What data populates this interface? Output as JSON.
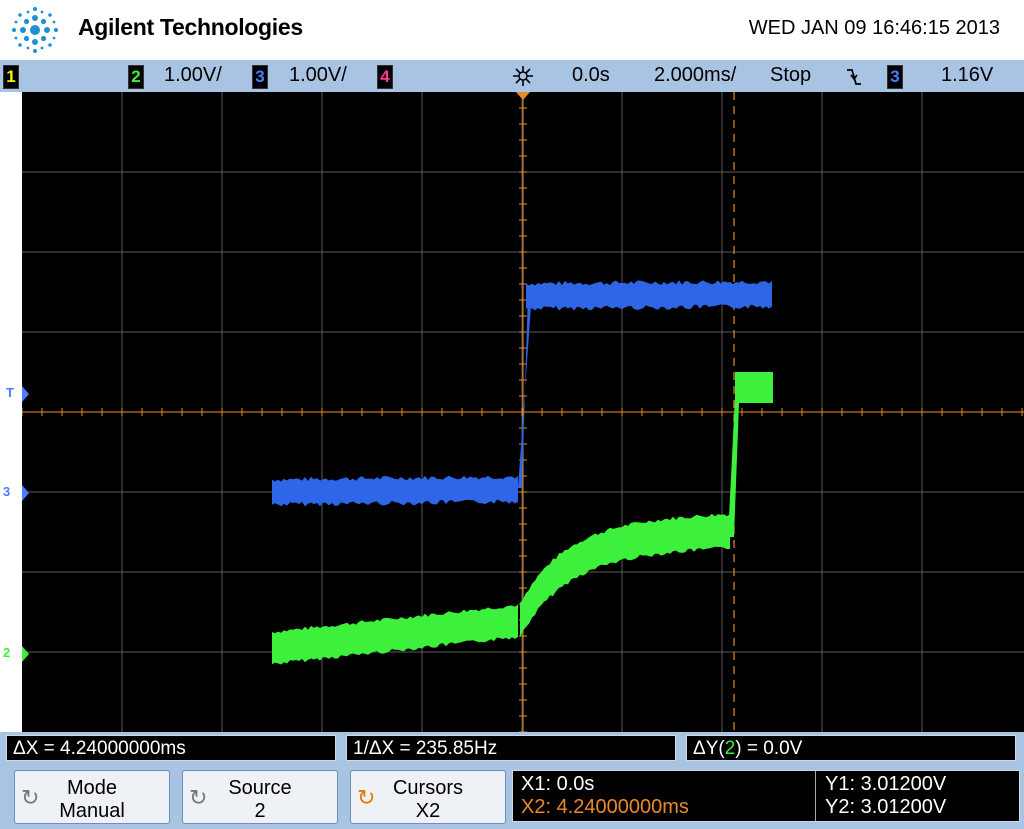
{
  "header": {
    "brand": "Agilent Technologies",
    "datetime": "WED JAN 09 16:46:15 2013"
  },
  "status_bar": {
    "channels": [
      {
        "id": "1",
        "scale": "",
        "color": "#f2f200"
      },
      {
        "id": "2",
        "scale": "1.00V/",
        "color": "#3cf03c"
      },
      {
        "id": "3",
        "scale": "1.00V/",
        "color": "#4a7dff"
      },
      {
        "id": "4",
        "scale": "",
        "color": "#ff3c8c"
      }
    ],
    "time_delay": "0.0s",
    "time_scale": "2.000ms/",
    "run_state": "Stop",
    "trigger_slope_icon": "falling-edge-icon",
    "trigger_source": "3",
    "trigger_level": "1.16V"
  },
  "screen": {
    "ground_markers": [
      {
        "label": "T",
        "color": "#4a7dff"
      },
      {
        "label": "3",
        "color": "#4a7dff"
      },
      {
        "label": "2",
        "color": "#3cf03c"
      }
    ],
    "trace_colors": {
      "ch2": "#3cf03c",
      "ch3": "#2f66e8",
      "cursor": "#e88a2a",
      "grid": "#5a5a5a"
    }
  },
  "measurements": {
    "delta_x": "ΔX = 4.24000000ms",
    "inv_delta_x": "1/ΔX = 235.85Hz",
    "delta_y_prefix": "ΔY(",
    "delta_y_channel": "2",
    "delta_y_suffix": ") = 0.0V"
  },
  "softkeys": [
    {
      "line1": "Mode",
      "line2": "Manual",
      "icon": "rotate-knob-icon"
    },
    {
      "line1": "Source",
      "line2": "2",
      "icon": "rotate-knob-icon"
    },
    {
      "line1": "Cursors",
      "line2": "X2",
      "icon": "rotate-knob-active-icon"
    }
  ],
  "cursor_readout": {
    "x1": "X1: 0.0s",
    "x2": "X2: 4.24000000ms",
    "y1": "Y1: 3.01200V",
    "y2": "Y2: 3.01200V"
  }
}
